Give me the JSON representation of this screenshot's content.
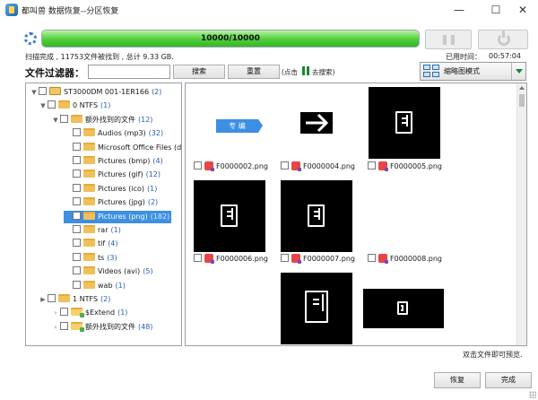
{
  "window": {
    "title": "都叫兽 数据恢复--分区恢复",
    "minimize": "—",
    "maximize": "☐",
    "close": "✕"
  },
  "scan": {
    "progress_text": "10000/10000",
    "progress_fraction": 1.0,
    "status": "扫描完成 , 11753文件被找到 , 总计 9.33 GB.",
    "elapsed_label": "已用时间：",
    "elapsed_value": "00:57:04"
  },
  "filter": {
    "label": "文件过滤器：",
    "input_value": "",
    "search_label": "搜索",
    "reset_label": "重置",
    "hint_prefix": "(点击",
    "hint_suffix": "去搜索)"
  },
  "view_mode": {
    "selected": "缩略图模式"
  },
  "tree": [
    {
      "label": "ST3000DM 001-1ER166",
      "count": "(2)",
      "level": 0,
      "expander": "▼",
      "icon": "drive"
    },
    {
      "label": "0 NTFS",
      "count": "(1)",
      "level": 1,
      "expander": "▼",
      "icon": "folder"
    },
    {
      "label": "额外找到的文件",
      "count": "(12)",
      "level": 2,
      "expander": "▼",
      "icon": "folder"
    },
    {
      "label": "Audios (mp3)",
      "count": "(32)",
      "level": 3,
      "expander": "",
      "icon": "folder"
    },
    {
      "label": "Microsoft Office Files (d",
      "count": "",
      "level": 3,
      "expander": "",
      "icon": "folder"
    },
    {
      "label": "Pictures (bmp)",
      "count": "(4)",
      "level": 3,
      "expander": "",
      "icon": "folder"
    },
    {
      "label": "Pictures (gif)",
      "count": "(12)",
      "level": 3,
      "expander": "",
      "icon": "folder"
    },
    {
      "label": "Pictures (ico)",
      "count": "(1)",
      "level": 3,
      "expander": "",
      "icon": "folder"
    },
    {
      "label": "Pictures (jpg)",
      "count": "(2)",
      "level": 3,
      "expander": "",
      "icon": "folder"
    },
    {
      "label": "Pictures (png)",
      "count": "(182)",
      "level": 3,
      "expander": "",
      "icon": "folder",
      "selected": true
    },
    {
      "label": "rar",
      "count": "(1)",
      "level": 3,
      "expander": "",
      "icon": "folder"
    },
    {
      "label": "tif",
      "count": "(4)",
      "level": 3,
      "expander": "",
      "icon": "folder"
    },
    {
      "label": "ts",
      "count": "(3)",
      "level": 3,
      "expander": "",
      "icon": "folder"
    },
    {
      "label": "Videos (avi)",
      "count": "(5)",
      "level": 3,
      "expander": "",
      "icon": "folder"
    },
    {
      "label": "wab",
      "count": "(1)",
      "level": 3,
      "expander": "",
      "icon": "folder"
    },
    {
      "label": "1 NTFS",
      "count": "(2)",
      "level": 1,
      "expander": "▶",
      "icon": "folder"
    },
    {
      "label": "$Extend",
      "count": "(1)",
      "level": 2,
      "expander": "›",
      "icon": "special"
    },
    {
      "label": "额外找到的文件",
      "count": "(48)",
      "level": 2,
      "expander": "›",
      "icon": "special"
    }
  ],
  "gallery": {
    "tag_text": "专 编",
    "files": [
      {
        "name": "F0000002.png"
      },
      {
        "name": "F0000004.png"
      },
      {
        "name": "F0000005.png"
      },
      {
        "name": "F0000006.png"
      },
      {
        "name": "F0000007.png"
      },
      {
        "name": "F0000008.png"
      }
    ]
  },
  "footer": {
    "hint": "双击文件即可预览.",
    "restore_label": "恢复",
    "done_label": "完成"
  },
  "colors": {
    "progress_green": "#4fcf3a",
    "selection_blue": "#3d8fe3",
    "count_blue": "#2a5db0"
  }
}
